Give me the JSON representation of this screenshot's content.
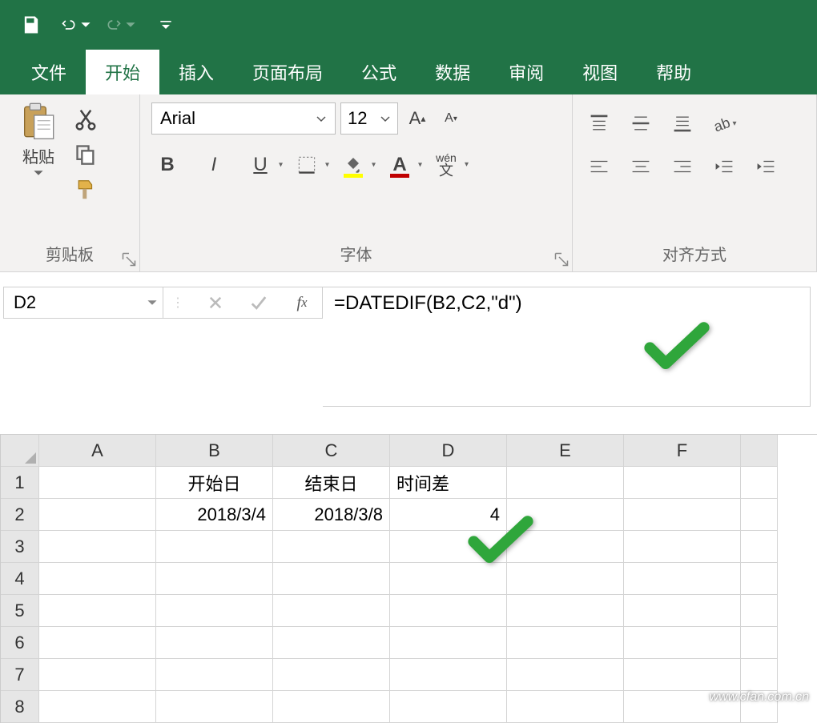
{
  "qat": {
    "save": "save-icon",
    "undo": "undo-icon",
    "redo": "redo-icon",
    "custom": "customize-icon"
  },
  "tabs": {
    "file": "文件",
    "home": "开始",
    "insert": "插入",
    "layout": "页面布局",
    "formulas": "公式",
    "data": "数据",
    "review": "审阅",
    "view": "视图",
    "help": "帮助"
  },
  "ribbon": {
    "clipboard": {
      "paste": "粘贴",
      "group_label": "剪贴板"
    },
    "font": {
      "name": "Arial",
      "size": "12",
      "bold": "B",
      "italic": "I",
      "underline": "U",
      "wen": "wén",
      "wen_sub": "文",
      "grow": "A",
      "shrink": "A",
      "font_A": "A",
      "group_label": "字体"
    },
    "align": {
      "group_label": "对齐方式"
    }
  },
  "namebox": "D2",
  "formula": "=DATEDIF(B2,C2,\"d\")",
  "grid": {
    "cols": [
      "A",
      "B",
      "C",
      "D",
      "E",
      "F"
    ],
    "rows": [
      "1",
      "2",
      "3",
      "4",
      "5",
      "6",
      "7",
      "8"
    ],
    "B1": "开始日",
    "C1": "结束日",
    "D1": "时间差",
    "B2": "2018/3/4",
    "C2": "2018/3/8",
    "D2": "4"
  },
  "watermark": "www.cfan.com.cn"
}
